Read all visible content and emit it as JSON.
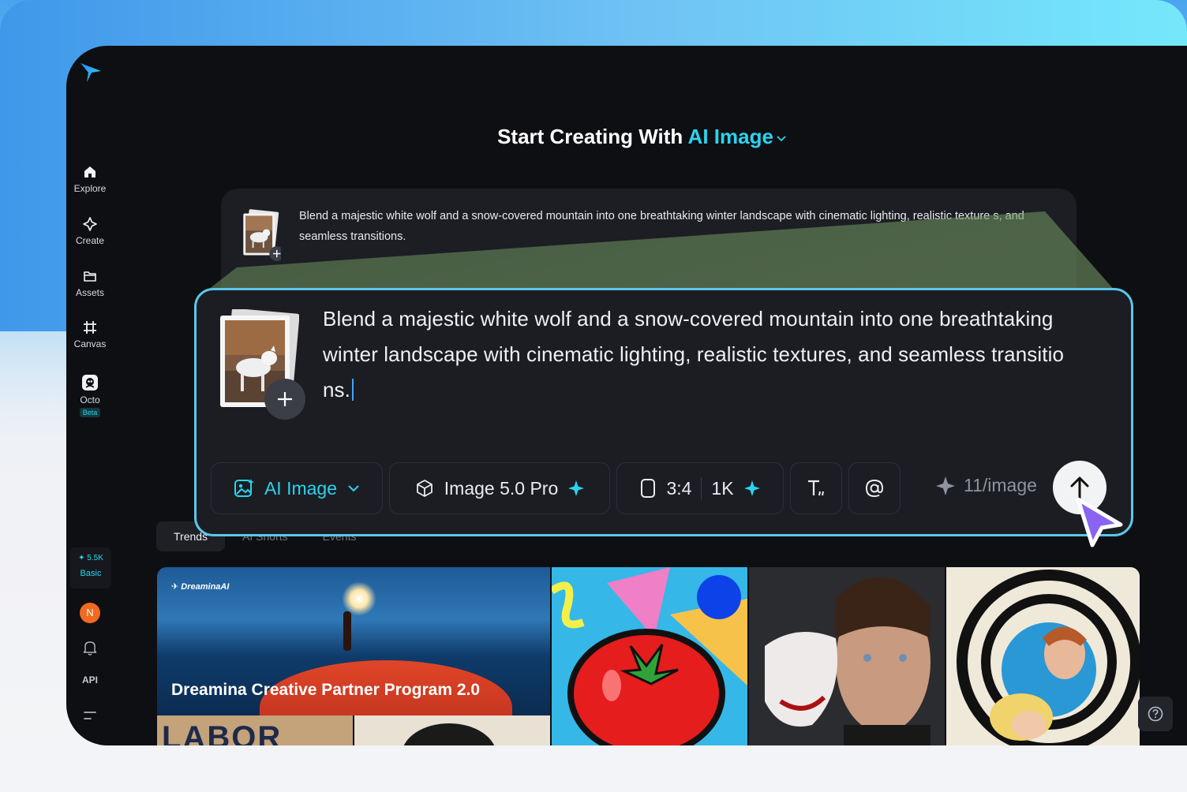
{
  "heading": {
    "prefix": "Start Creating With",
    "mode": "AI Image"
  },
  "sidebar": {
    "items": [
      {
        "label": "Explore",
        "icon": "home-icon"
      },
      {
        "label": "Create",
        "icon": "sparkle-outline-icon"
      },
      {
        "label": "Assets",
        "icon": "folder-icon"
      },
      {
        "label": "Canvas",
        "icon": "crop-grid-icon"
      },
      {
        "label": "Octo",
        "icon": "octo-icon",
        "badge": "Beta"
      }
    ],
    "credits": {
      "amount": "5.5K",
      "plan": "Basic"
    },
    "avatar_initial": "N",
    "api_label": "API"
  },
  "prompt_small": {
    "text": "Blend a majestic white wolf and a snow-covered mountain into one breathtaking winter landscape with cinematic lighting, realistic texture s, and seamless transitions."
  },
  "prompt_big": {
    "line1": "Blend a majestic white wolf and a snow-covered mountain into one breathtaking",
    "line2": "winter landscape with cinematic lighting, realistic textures, and seamless transitio",
    "line3": "ns."
  },
  "toolbar": {
    "mode_label": "AI Image",
    "model_label": "Image 5.0 Pro",
    "ratio_label": "3:4",
    "resolution_label": "1K",
    "cost_label": "11/image"
  },
  "tabs": [
    "Trends",
    "AI Shorts",
    "Events"
  ],
  "gallery": {
    "brand": "DreaminaAI",
    "featured_title": "Dreamina Creative Partner Program 2.0",
    "poster_text": "LABOR DAY"
  },
  "colors": {
    "accent": "#2bd3ee",
    "app_bg": "#0e0f13",
    "card_bg": "#1b1d23",
    "highlight_border": "#5cc6ec",
    "cursor": "#8a63f2"
  }
}
